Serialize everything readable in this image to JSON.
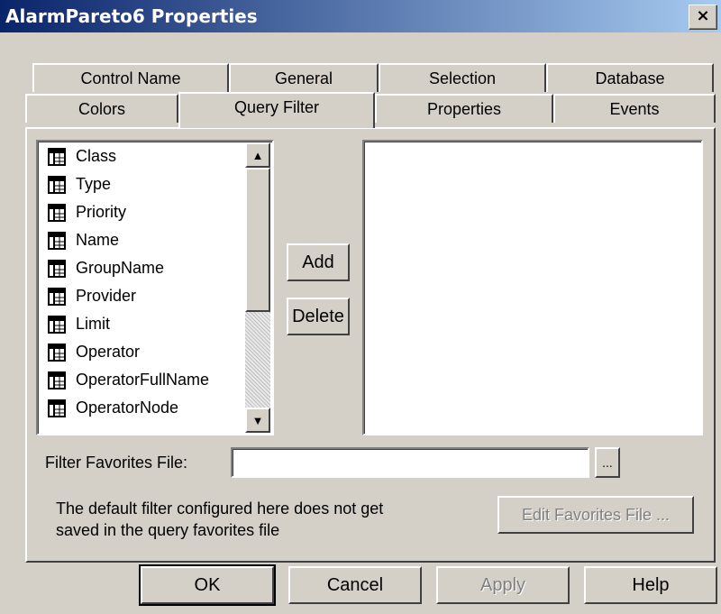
{
  "window": {
    "title": "AlarmPareto6 Properties",
    "close": "×"
  },
  "tabs_row1": [
    "Control Name",
    "General",
    "Selection",
    "Database"
  ],
  "tabs_row2": [
    "Colors",
    "Query Filter",
    "Properties",
    "Events"
  ],
  "fields_list": [
    "Class",
    "Type",
    "Priority",
    "Name",
    "GroupName",
    "Provider",
    "Limit",
    "Operator",
    "OperatorFullName",
    "OperatorNode"
  ],
  "buttons": {
    "add": "Add",
    "delete": "Delete",
    "browse": "...",
    "edit_favorites": "Edit Favorites File ...",
    "ok": "OK",
    "cancel": "Cancel",
    "apply": "Apply",
    "help": "Help"
  },
  "filter_favorites": {
    "label": "Filter Favorites File:",
    "value": ""
  },
  "note": {
    "line1": "The default filter configured here does not get",
    "line2": "saved in the query favorites file"
  },
  "icons": {
    "field": "table-grid-icon",
    "up": "up-arrow-icon",
    "down": "down-arrow-icon"
  }
}
